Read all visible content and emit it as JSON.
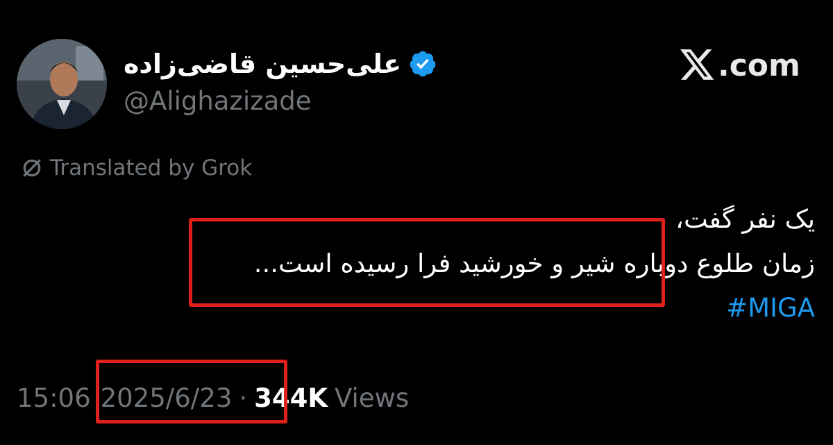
{
  "author": {
    "display_name": "علی‌حسین قاضی‌زاده",
    "handle": "@Alighazizade",
    "verified": true
  },
  "brand": {
    "text": ".com",
    "logo_icon": "x-logo-icon"
  },
  "translation_notice": {
    "text": "Translated by Grok",
    "icon": "grok-icon"
  },
  "tweet": {
    "lines": [
      "یک نفر گفت،",
      "زمان طلوع دوباره شیر و خورشید فرا رسیده است..."
    ],
    "hashtag": "#MIGA"
  },
  "meta": {
    "time": "15:06",
    "date": "2025/6/23",
    "separator": "·",
    "views_count": "344K",
    "views_label": "Views"
  },
  "colors": {
    "background": "#000000",
    "text_primary": "#ffffff",
    "text_secondary": "#71767b",
    "link": "#1d9bf0",
    "verified": "#1d9bf0",
    "highlight": "#e0201b"
  }
}
